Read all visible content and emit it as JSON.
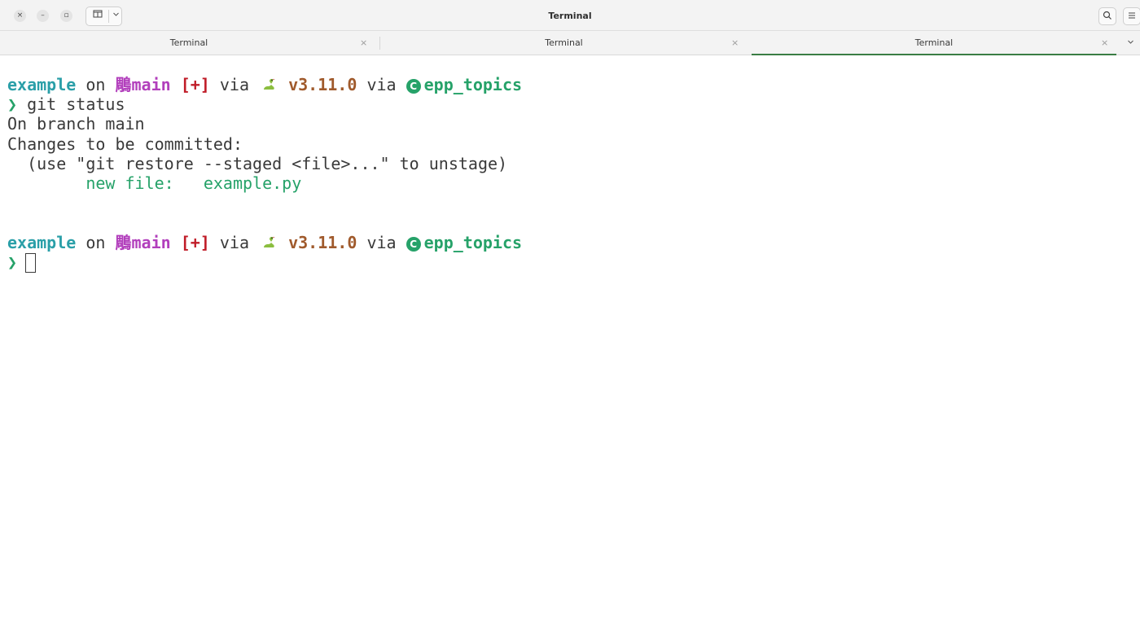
{
  "window": {
    "title": "Terminal",
    "close_glyph": "×",
    "minimize_glyph": "–",
    "maximize_glyph": "▫"
  },
  "tabs": [
    {
      "label": "Terminal",
      "active": false
    },
    {
      "label": "Terminal",
      "active": false
    },
    {
      "label": "Terminal",
      "active": true
    }
  ],
  "tab_close_glyph": "×",
  "icons": {
    "new_tab": "split-window-icon",
    "new_tab_menu": "chevron-down-icon",
    "search": "search-icon",
    "menu": "hamburger-menu-icon",
    "python": "snake-icon",
    "conda": "conda-c-icon",
    "branch": "branch-symbol-icon"
  },
  "prompt": {
    "directory": "example",
    "on_word": "on",
    "branch_symbol": "鵰",
    "branch": "main",
    "git_status": "[+]",
    "via_word": "via",
    "python_version": "v3.11.0",
    "conda_letter": "C",
    "conda_env": "epp_topics",
    "prompt_char": "❯"
  },
  "terminal": {
    "command": "git status",
    "output": [
      "On branch main",
      "Changes to be committed:",
      "  (use \"git restore --staged <file>...\" to unstage)"
    ],
    "new_file_label": "new file:",
    "new_file_name": "example.py"
  },
  "colors": {
    "directory": "#2a9fa8",
    "branch": "#b23fbc",
    "git_status": "#c01c28",
    "python": "#a05a2c",
    "conda": "#26a269",
    "active_tab_indicator": "#3a7d44"
  }
}
